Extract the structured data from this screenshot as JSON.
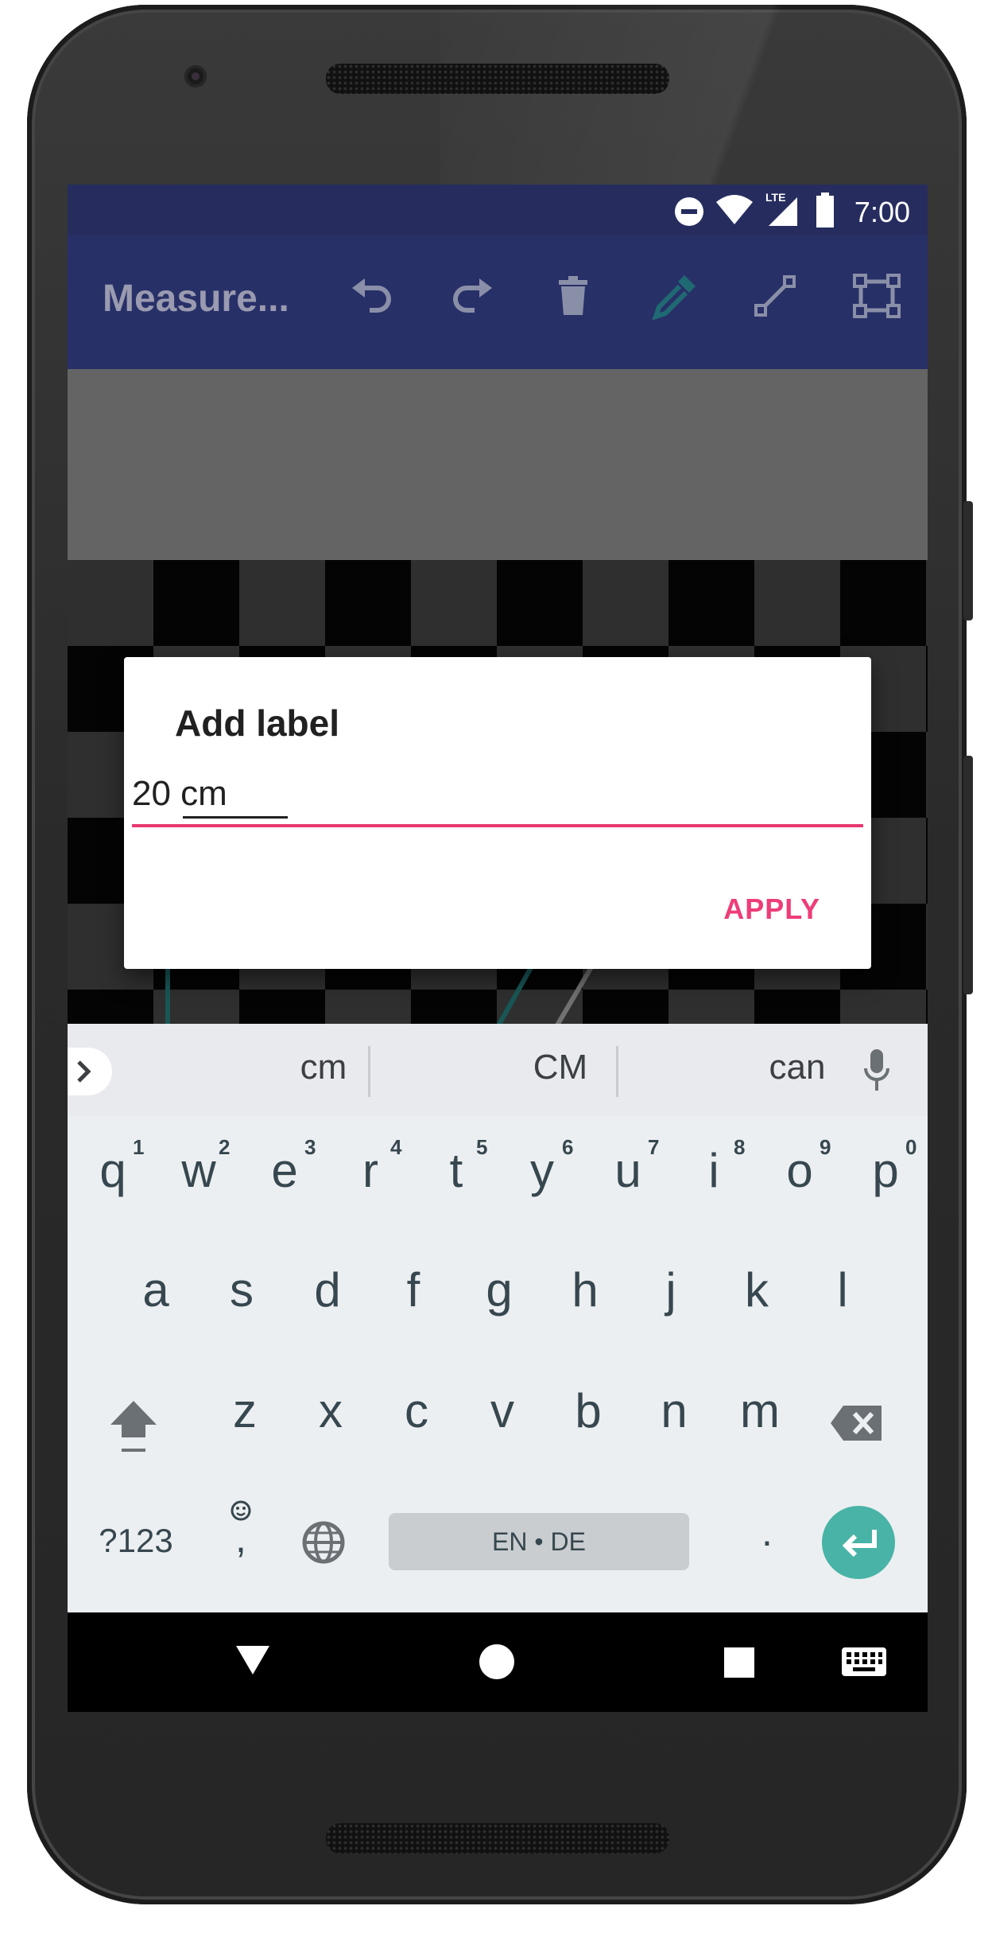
{
  "status_bar": {
    "time": "7:00",
    "network": "LTE",
    "icons": [
      "do-not-disturb-icon",
      "wifi-icon",
      "signal-icon",
      "battery-icon"
    ]
  },
  "toolbar": {
    "title": "Measure...",
    "actions": [
      "undo-icon",
      "redo-icon",
      "trash-icon",
      "eyedropper-icon",
      "line-tool-icon",
      "rectangle-select-icon"
    ],
    "active_action": "eyedropper-icon"
  },
  "dialog": {
    "title": "Add label",
    "input_value": "20 cm",
    "apply_label": "APPLY"
  },
  "keyboard": {
    "suggestions": [
      "cm",
      "CM",
      "can"
    ],
    "row1": [
      "q",
      "w",
      "e",
      "r",
      "t",
      "y",
      "u",
      "i",
      "o",
      "p"
    ],
    "row1_hints": [
      "1",
      "2",
      "3",
      "4",
      "5",
      "6",
      "7",
      "8",
      "9",
      "0"
    ],
    "row2": [
      "a",
      "s",
      "d",
      "f",
      "g",
      "h",
      "j",
      "k",
      "l"
    ],
    "row3": [
      "z",
      "x",
      "c",
      "v",
      "b",
      "n",
      "m"
    ],
    "symbols_label": "?123",
    "comma_label": ",",
    "space_label": "EN • DE",
    "period_label": "."
  },
  "colors": {
    "app_bar": "#283068",
    "accent": "#ee3d79",
    "enter_key": "#48b3a6",
    "drawn_line": "#1f6a6a"
  }
}
